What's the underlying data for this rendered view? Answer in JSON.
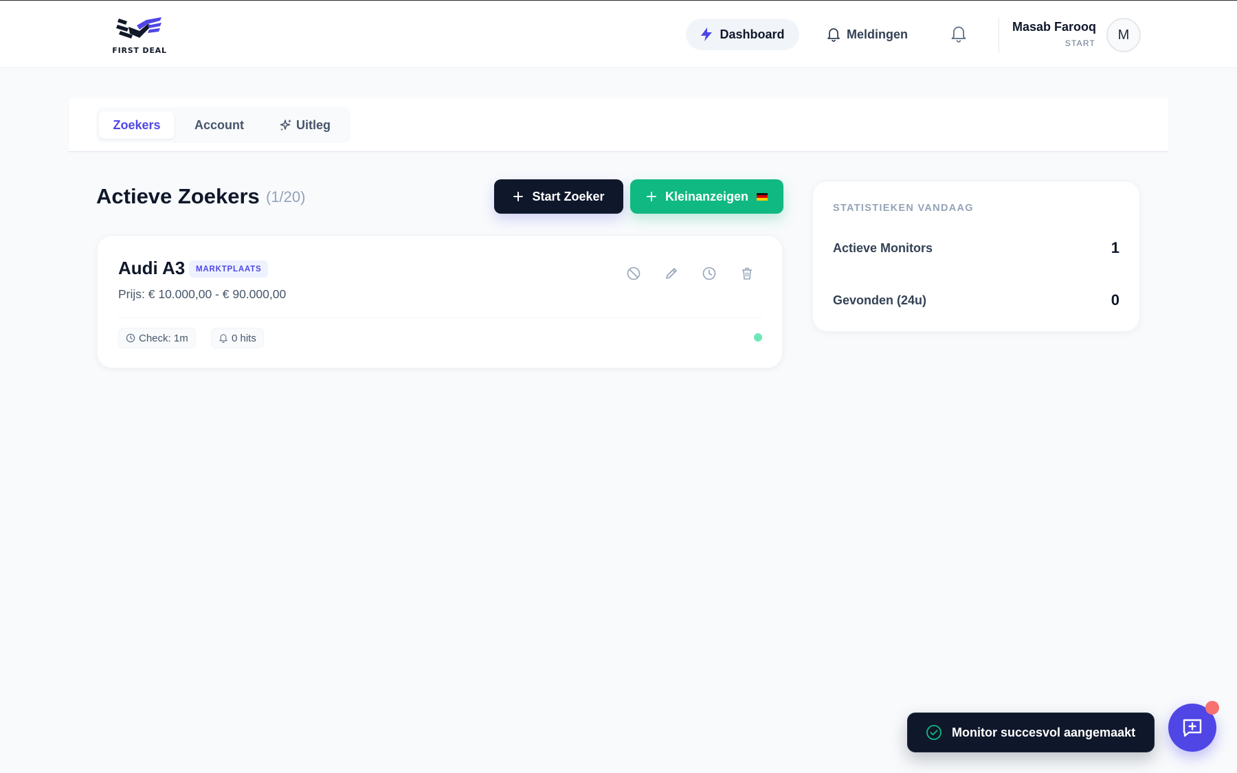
{
  "brand": {
    "logo_text": "FIRST DEAL",
    "accent": "#4f46e5",
    "success": "#10b981",
    "dark": "#0f172a"
  },
  "header": {
    "nav_dashboard": "Dashboard",
    "nav_meldingen": "Meldingen",
    "user_name": "Masab Farooq",
    "user_plan": "START",
    "avatar_initial": "M"
  },
  "tabs": {
    "zoekers": "Zoekers",
    "account": "Account",
    "uitleg": "Uitleg"
  },
  "main": {
    "title": "Actieve Zoekers",
    "count": "(1/20)",
    "start_button": "Start Zoeker",
    "kleinanzeigen_button": "Kleinanzeigen"
  },
  "monitors": [
    {
      "title": "Audi A3",
      "source": "MARKTPLAATS",
      "price": "Prijs: € 10.000,00 - € 90.000,00",
      "check": "Check: 1m",
      "hits": "0 hits",
      "actions": [
        "ban-icon",
        "edit-icon",
        "clock-icon",
        "trash-icon"
      ]
    }
  ],
  "stats": {
    "heading": "STATISTIEKEN VANDAAG",
    "rows": [
      {
        "label": "Actieve Monitors",
        "value": "1"
      },
      {
        "label": "Gevonden (24u)",
        "value": "0"
      }
    ]
  },
  "toast": {
    "message": "Monitor succesvol aangemaakt"
  }
}
